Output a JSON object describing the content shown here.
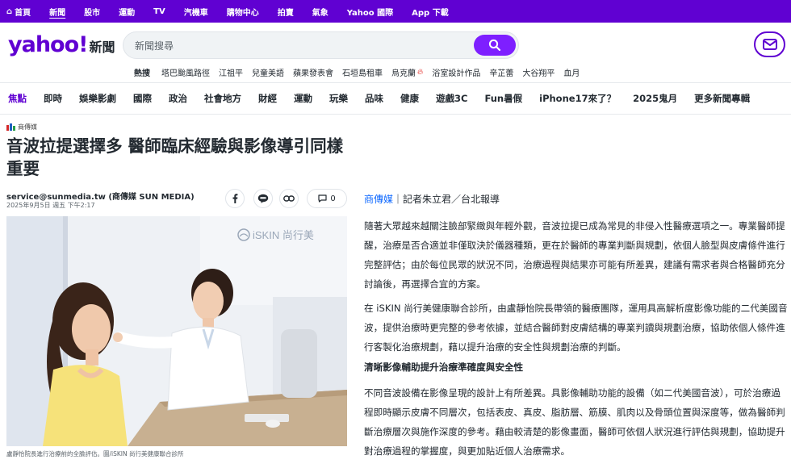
{
  "topbar": {
    "items": [
      "首頁",
      "新聞",
      "股市",
      "運動",
      "TV",
      "汽機車",
      "購物中心",
      "拍賣",
      "氣象",
      "Yahoo 國際",
      "App 下載"
    ],
    "active_index": 1
  },
  "header": {
    "logo_text": "yahoo!",
    "logo_sub": "新聞",
    "search_placeholder": "新聞搜尋",
    "trending_label": "熱搜",
    "trending": [
      "塔巴颱風路徑",
      "江祖平",
      "兒童美語",
      "蘋果發表會",
      "石垣島租車",
      "烏克蘭",
      "浴室設計作品",
      "辛芷蕾",
      "大谷翔平",
      "血月"
    ],
    "trending_hot_index": 5
  },
  "categories": {
    "items": [
      "焦點",
      "即時",
      "娛樂影劇",
      "國際",
      "政治",
      "社會地方",
      "財經",
      "運動",
      "玩樂",
      "品味",
      "健康",
      "遊戲3C",
      "Fun暑假",
      "iPhone17來了？",
      "2025鬼月",
      "更多新聞專輯"
    ],
    "active_index": 0
  },
  "article": {
    "source_logo": "商傳媒",
    "title": "音波拉提選擇多 醫師臨床經驗與影像導引同樣重要",
    "author": "service@sunmedia.tw (商傳媒 SUN MEDIA)",
    "date": "2025年9月5日 週五 下午2:17",
    "comment_count": "0",
    "photo_watermark": "iSKIN 尚行美",
    "caption": "盧靜怡院長進行治療前的全臉評估。圖/iSKIN 尚行美健康聯合診所",
    "byline_source": "商傳媒",
    "byline_rest": "｜記者朱立君／台北報導",
    "para1": "隨著大眾越來越關注臉部緊緻與年輕外觀，音波拉提已成為常見的非侵入性醫療選項之一。專業醫師提醒，治療是否合適並非僅取決於儀器種類，更在於醫師的專業判斷與規劃，依個人臉型與皮膚條件進行完整評估；由於每位民眾的狀況不同，治療過程與結果亦可能有所差異，建議有需求者與合格醫師充分討論後，再選擇合宜的方案。",
    "para2": "在 iSKIN 尚行美健康聯合診所，由盧靜怡院長帶領的醫療團隊，運用具高解析度影像功能的二代美國音波，提供治療時更完整的參考依據，並結合醫師對皮膚結構的專業判讀與規劃治療，協助依個人條件進行客製化治療規劃，藉以提升治療的安全性與規劃治療的判斷。",
    "subhead": "清晰影像輔助提升治療準確度與安全性",
    "para3": "不同音波設備在影像呈現的設計上有所差異。具影像輔助功能的設備（如二代美國音波），可於治療過程即時顯示皮膚不同層次，包括表皮、真皮、脂肪層、筋膜、肌肉以及骨頭位置與深度等，做為醫師判斷治療層次與施作深度的參考。藉由較清楚的影像畫面，醫師可依個人狀況進行評估與規劃，協助提升對治療過程的掌握度，與更加貼近個人治療需求。"
  },
  "colors": {
    "brand": "#6001d2",
    "search_button": "#7e1fff",
    "link": "#0f69ff"
  }
}
